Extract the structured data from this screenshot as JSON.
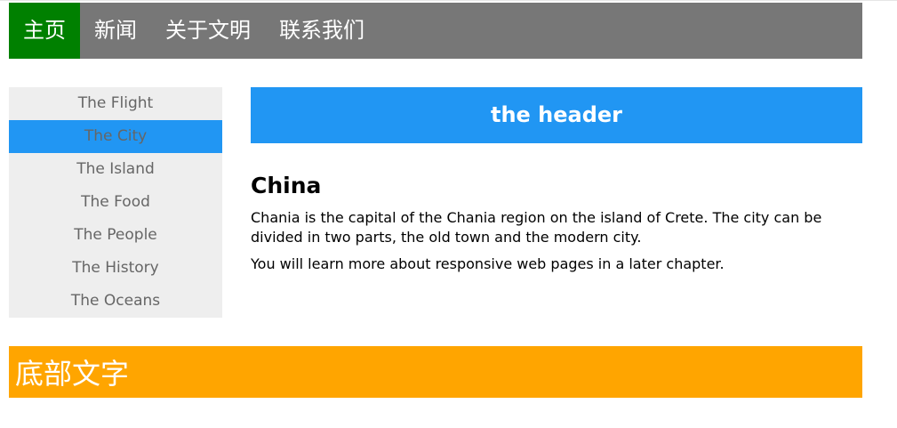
{
  "topnav": {
    "items": [
      "主页",
      "新闻",
      "关于文明",
      "联系我们"
    ],
    "active_index": 0
  },
  "sidebar": {
    "items": [
      "The Flight",
      "The City",
      "The Island",
      "The Food",
      "The People",
      "The History",
      "The Oceans"
    ],
    "active_index": 1
  },
  "header": {
    "title": "the header"
  },
  "content": {
    "heading": "China",
    "paragraph1": "Chania is the capital of the Chania region on the island of Crete. The city can be divided in two parts, the old town and the modern city.",
    "paragraph2": "You will learn more about responsive web pages in a later chapter."
  },
  "footer": {
    "text": "底部文字"
  },
  "colors": {
    "nav_bg": "#777777",
    "nav_active": "#008000",
    "sidebar_bg": "#eeeeee",
    "accent_blue": "#2196f3",
    "footer_bg": "#ffa500"
  }
}
